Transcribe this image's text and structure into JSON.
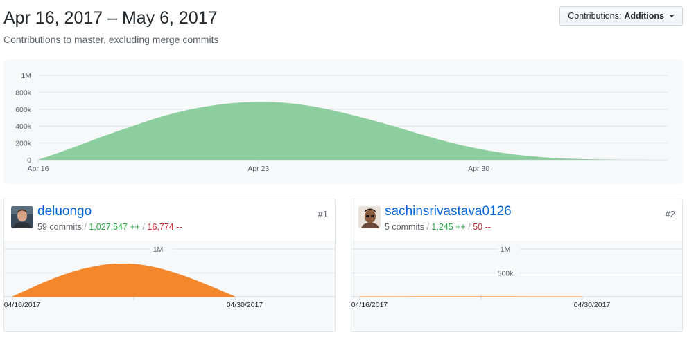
{
  "header": {
    "title": "Apr 16, 2017 – May 6, 2017",
    "subtitle": "Contributions to master, excluding merge commits",
    "contributions_label": "Contributions:",
    "contributions_value": "Additions"
  },
  "chart_data": [
    {
      "type": "area",
      "x": [
        "Apr 16",
        "Apr 17",
        "Apr 18",
        "Apr 19",
        "Apr 20",
        "Apr 21",
        "Apr 22",
        "Apr 23",
        "Apr 24",
        "Apr 25",
        "Apr 26",
        "Apr 27",
        "Apr 28",
        "Apr 29",
        "Apr 30",
        "May 1",
        "May 2",
        "May 3",
        "May 4",
        "May 5",
        "May 6"
      ],
      "values": [
        0,
        130000,
        270000,
        400000,
        520000,
        610000,
        665000,
        685000,
        670000,
        615000,
        530000,
        430000,
        320000,
        215000,
        130000,
        70000,
        32000,
        12000,
        4000,
        1000,
        0
      ],
      "yticks": [
        "0",
        "200k",
        "400k",
        "600k",
        "800k",
        "1M"
      ],
      "ylim": [
        0,
        1000000
      ],
      "xticks": [
        "Apr 16",
        "Apr 23",
        "Apr 30"
      ],
      "color": "#8cce9d"
    },
    {
      "type": "area",
      "x": [
        "04/16/2017",
        "04/17/2017",
        "04/18/2017",
        "04/19/2017",
        "04/20/2017",
        "04/21/2017",
        "04/22/2017",
        "04/23/2017",
        "04/24/2017",
        "04/25/2017",
        "04/26/2017",
        "04/27/2017",
        "04/28/2017",
        "04/29/2017",
        "04/30/2017"
      ],
      "values": [
        0,
        150000,
        300000,
        430000,
        540000,
        620000,
        675000,
        690000,
        670000,
        610000,
        520000,
        410000,
        280000,
        140000,
        0
      ],
      "ylim": [
        0,
        1000000
      ],
      "ytick_label": "1M",
      "xticks": [
        "04/16/2017",
        "04/30/2017"
      ],
      "color": "#f4862c"
    },
    {
      "type": "area",
      "x": [
        "04/16/2017",
        "04/23/2017",
        "04/30/2017"
      ],
      "values": [
        0,
        1245,
        0
      ],
      "ylim": [
        0,
        1000000
      ],
      "ytick_labels": [
        "1M",
        "500k"
      ],
      "xticks": [
        "04/16/2017",
        "04/30/2017"
      ],
      "color": "#f4862c"
    }
  ],
  "contributors": [
    {
      "username": "deluongo",
      "commits": "59 commits",
      "additions": "1,027,547 ++",
      "deletions": "16,774 --",
      "rank": "#1",
      "avatar_icon": "person-photo-avatar"
    },
    {
      "username": "sachinsrivastava0126",
      "commits": "5 commits",
      "additions": "1,245 ++",
      "deletions": "50 --",
      "rank": "#2",
      "avatar_icon": "person-photo-avatar"
    }
  ],
  "separator": "/"
}
